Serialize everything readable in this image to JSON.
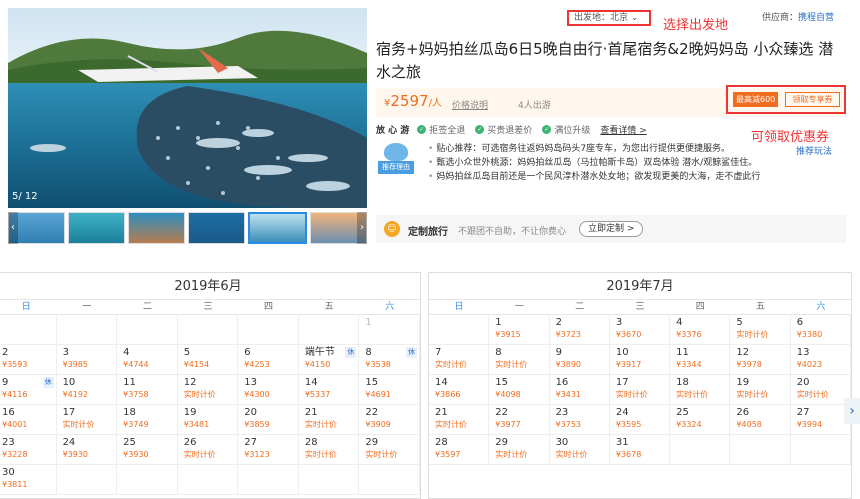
{
  "gallery": {
    "counter": "5/ 12"
  },
  "header": {
    "origin_label": "出发地：北京",
    "origin_annotation": "选择出发地",
    "supplier_label": "供应商：",
    "supplier_name": "携程自营"
  },
  "product": {
    "title": "宿务+妈妈拍丝瓜岛6日5晚自由行·首尾宿务&2晚妈妈岛 小众臻选 潜水之旅",
    "price_symbol": "¥",
    "price": "2597",
    "price_unit": "/人",
    "price_explain": "价格说明",
    "people": "4人出游",
    "coupon_tag": "最高减600",
    "coupon_button": "领取专享券",
    "coupon_annotation": "可领取优惠券"
  },
  "relax": {
    "name": "放 心 游",
    "items": [
      "拒签全退",
      "买贵退差价",
      "满位升级"
    ],
    "detail": "查看详情 >"
  },
  "recommend": {
    "badge": "推荐理由",
    "more": "推荐玩法",
    "items": [
      "贴心推荐：可选宿务往返妈妈岛码头7座专车，为您出行提供更便捷服务。",
      "甄选小众世外桃源：妈妈拍丝瓜岛（马拉帕斯卡岛）双岛体验 潜水/观鲸鲨佳住。",
      "妈妈拍丝瓜岛目前还是一个民风淳朴潜水处女地；欲发现更美的大海，走不虚此行"
    ]
  },
  "custom": {
    "title": "定制旅行",
    "desc": "不跟团不自助，不让你费心",
    "button": "立即定制 >"
  },
  "weekdays": [
    "日",
    "一",
    "二",
    "三",
    "四",
    "五",
    "六"
  ],
  "calendars": [
    {
      "title": "2019年6月",
      "days": [
        null,
        null,
        null,
        null,
        null,
        null,
        {
          "n": "1",
          "p": "",
          "dim": true
        },
        {
          "n": "2",
          "p": "¥3593"
        },
        {
          "n": "3",
          "p": "¥3985"
        },
        {
          "n": "4",
          "p": "¥4744"
        },
        {
          "n": "5",
          "p": "¥4154"
        },
        {
          "n": "6",
          "p": "¥4253"
        },
        {
          "n": "端午节",
          "p": "¥4150",
          "h": "休"
        },
        {
          "n": "8",
          "p": "¥3538",
          "h": "休"
        },
        {
          "n": "9",
          "p": "¥4116",
          "h": "休"
        },
        {
          "n": "10",
          "p": "¥4192"
        },
        {
          "n": "11",
          "p": "¥3758"
        },
        {
          "n": "12",
          "p": "实时计价"
        },
        {
          "n": "13",
          "p": "¥4300"
        },
        {
          "n": "14",
          "p": "¥5337"
        },
        {
          "n": "15",
          "p": "¥4691"
        },
        {
          "n": "16",
          "p": "¥4001"
        },
        {
          "n": "17",
          "p": "实时计价"
        },
        {
          "n": "18",
          "p": "¥3749"
        },
        {
          "n": "19",
          "p": "¥3481"
        },
        {
          "n": "20",
          "p": "¥3859"
        },
        {
          "n": "21",
          "p": "实时计价"
        },
        {
          "n": "22",
          "p": "¥3909"
        },
        {
          "n": "23",
          "p": "¥3228"
        },
        {
          "n": "24",
          "p": "¥3930"
        },
        {
          "n": "25",
          "p": "¥3930"
        },
        {
          "n": "26",
          "p": "实时计价"
        },
        {
          "n": "27",
          "p": "¥3123"
        },
        {
          "n": "28",
          "p": "实时计价"
        },
        {
          "n": "29",
          "p": "实时计价"
        },
        {
          "n": "30",
          "p": "¥3811"
        },
        null,
        null,
        null,
        null,
        null,
        null
      ]
    },
    {
      "title": "2019年7月",
      "days": [
        null,
        {
          "n": "1",
          "p": "¥3915"
        },
        {
          "n": "2",
          "p": "¥3723"
        },
        {
          "n": "3",
          "p": "¥3670"
        },
        {
          "n": "4",
          "p": "¥3376"
        },
        {
          "n": "5",
          "p": "实时计价"
        },
        {
          "n": "6",
          "p": "¥3380"
        },
        {
          "n": "7",
          "p": "实时计价"
        },
        {
          "n": "8",
          "p": "实时计价"
        },
        {
          "n": "9",
          "p": "¥3890"
        },
        {
          "n": "10",
          "p": "¥3917"
        },
        {
          "n": "11",
          "p": "¥3344"
        },
        {
          "n": "12",
          "p": "¥3978"
        },
        {
          "n": "13",
          "p": "¥4023"
        },
        {
          "n": "14",
          "p": "¥3866"
        },
        {
          "n": "15",
          "p": "¥4098"
        },
        {
          "n": "16",
          "p": "¥3431"
        },
        {
          "n": "17",
          "p": "实时计价"
        },
        {
          "n": "18",
          "p": "实时计价"
        },
        {
          "n": "19",
          "p": "实时计价"
        },
        {
          "n": "20",
          "p": "实时计价"
        },
        {
          "n": "21",
          "p": "实时计价"
        },
        {
          "n": "22",
          "p": "¥3977"
        },
        {
          "n": "23",
          "p": "¥3753"
        },
        {
          "n": "24",
          "p": "¥3595"
        },
        {
          "n": "25",
          "p": "¥3324"
        },
        {
          "n": "26",
          "p": "¥4058"
        },
        {
          "n": "27",
          "p": "¥3994"
        },
        {
          "n": "28",
          "p": "¥3597"
        },
        {
          "n": "29",
          "p": "实时计价"
        },
        {
          "n": "30",
          "p": "实时计价"
        },
        {
          "n": "31",
          "p": "¥3678"
        },
        null,
        null,
        null
      ]
    }
  ],
  "colors": {
    "accent": "#f26c1d",
    "annotation": "#e33333",
    "link": "#2a6ec8"
  }
}
